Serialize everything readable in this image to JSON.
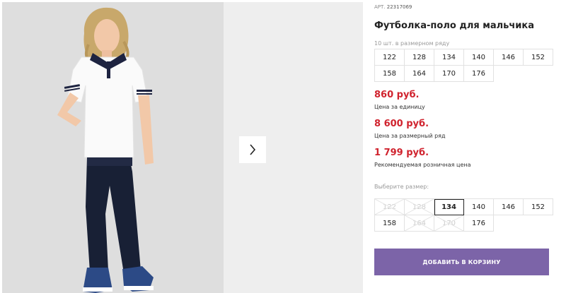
{
  "product": {
    "article_prefix": "АРТ.",
    "article_number": "22317069",
    "title": "Футболка-поло для мальчика",
    "pack_caption": "10 шт. в размерном ряду",
    "pack_sizes": [
      "122",
      "128",
      "134",
      "140",
      "146",
      "152",
      "158",
      "164",
      "170",
      "176"
    ]
  },
  "prices": {
    "unit_price": "860 руб.",
    "unit_label": "Цена за единицу",
    "pack_price": "8 600 руб.",
    "pack_label": "Цена за размерный ряд",
    "retail_price": "1 799 руб.",
    "retail_label": "Рекомендуемая розничная цена"
  },
  "size_selector": {
    "caption": "Выберите размер:",
    "options": [
      {
        "label": "122",
        "available": false
      },
      {
        "label": "128",
        "available": false
      },
      {
        "label": "134",
        "available": true,
        "selected": true
      },
      {
        "label": "140",
        "available": true
      },
      {
        "label": "146",
        "available": true
      },
      {
        "label": "152",
        "available": true
      },
      {
        "label": "158",
        "available": true
      },
      {
        "label": "164",
        "available": false
      },
      {
        "label": "170",
        "available": false
      },
      {
        "label": "176",
        "available": true
      }
    ]
  },
  "cart": {
    "add_label": "ДОБАВИТЬ В КОРЗИНУ"
  },
  "gallery": {
    "next_icon": "chevron-right-icon"
  },
  "colors": {
    "price": "#d0232e",
    "button": "#7c64a8",
    "photo_bg": "#dedede"
  }
}
